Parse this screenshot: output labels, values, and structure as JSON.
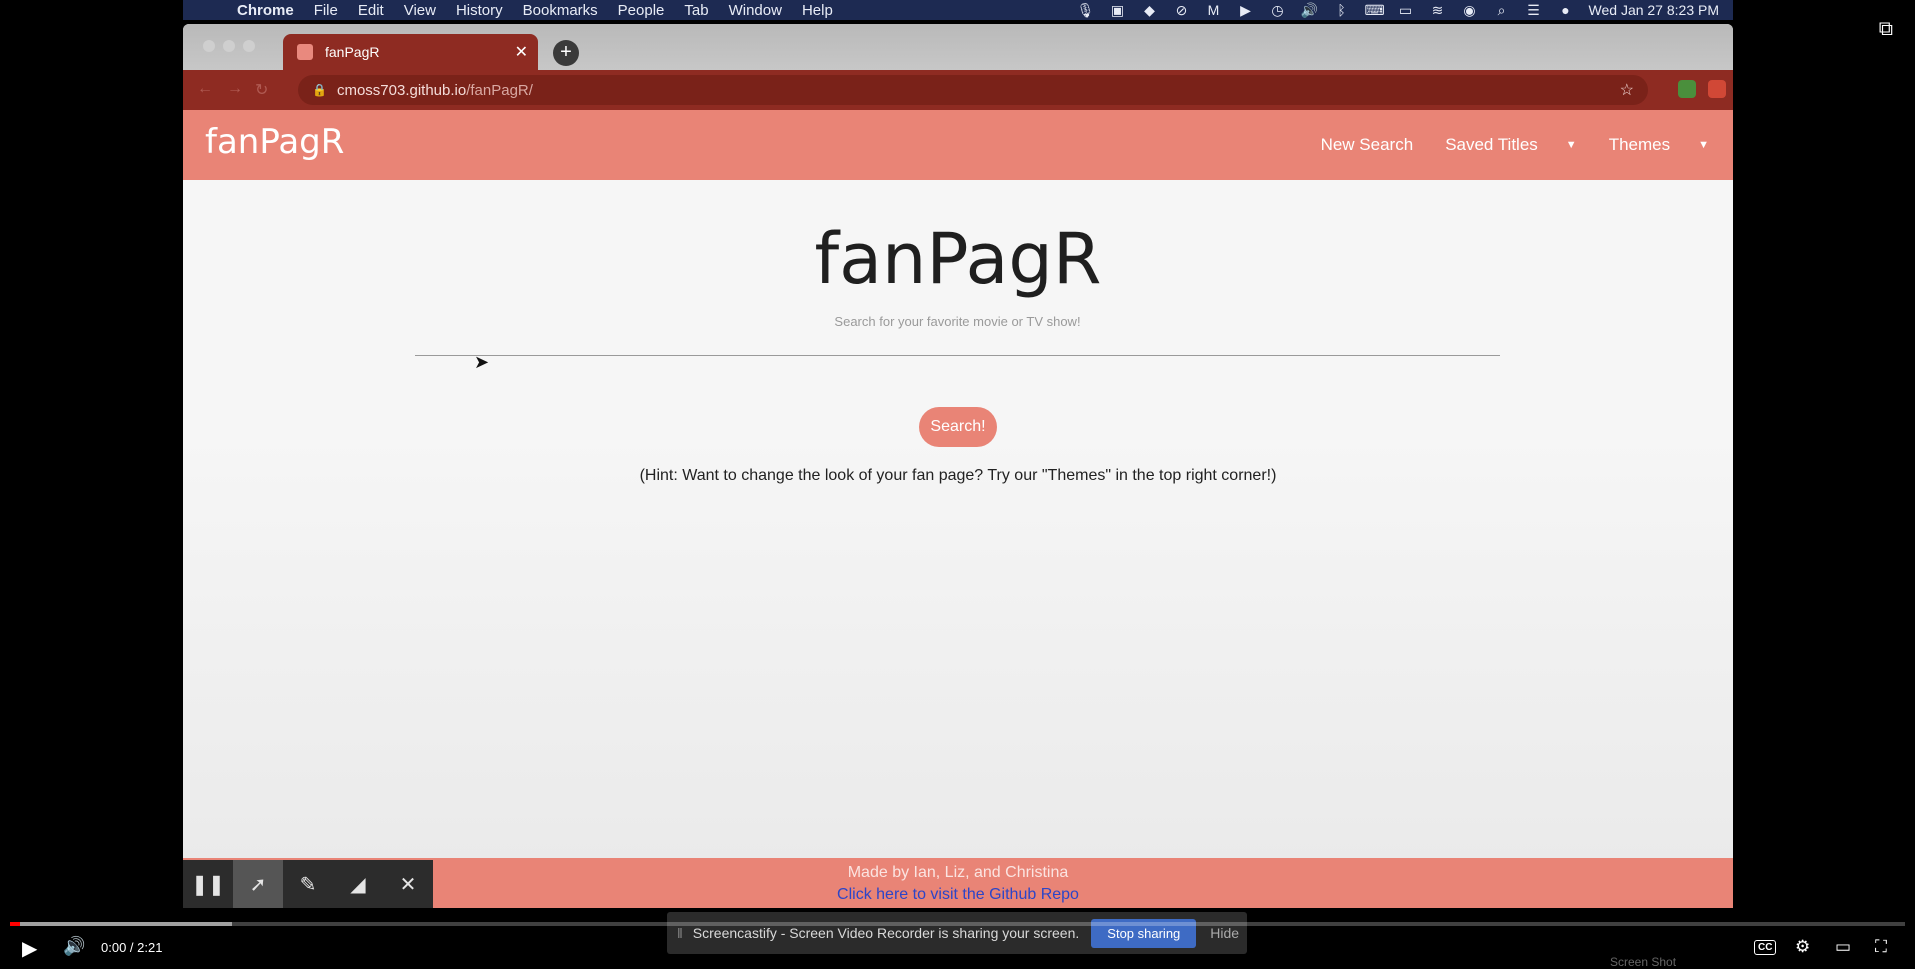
{
  "menubar": {
    "app_name": "Chrome",
    "items": [
      "File",
      "Edit",
      "View",
      "History",
      "Bookmarks",
      "People",
      "Tab",
      "Window",
      "Help"
    ],
    "datetime": "Wed Jan 27  8:23 PM"
  },
  "browser": {
    "tab_title": "fanPagR",
    "url_host": "cmoss703.github.io",
    "url_path": "/fanPagR/"
  },
  "site": {
    "brand": "fanPagR",
    "nav": {
      "new_search": "New Search",
      "saved_titles": "Saved Titles",
      "themes": "Themes"
    },
    "hero_title": "fanPagR",
    "search_placeholder": "Search for your favorite movie or TV show!",
    "search_button": "Search!",
    "hint": "(Hint: Want to change the look of your fan page? Try our \"Themes\" in the top right corner!)",
    "footer_credit": "Made by Ian, Liz, and Christina",
    "footer_link": "Click here to visit the Github Repo",
    "accent_color": "#e98476"
  },
  "screencastify": {
    "sharing_text": "Screencastify - Screen Video Recorder is sharing your screen.",
    "stop_button": "Stop sharing",
    "hide_link": "Hide"
  },
  "player": {
    "time": "0:00 / 2:21",
    "cc_label": "CC",
    "progress_fraction": 0.005
  },
  "overlay_label": "Screen Shot"
}
